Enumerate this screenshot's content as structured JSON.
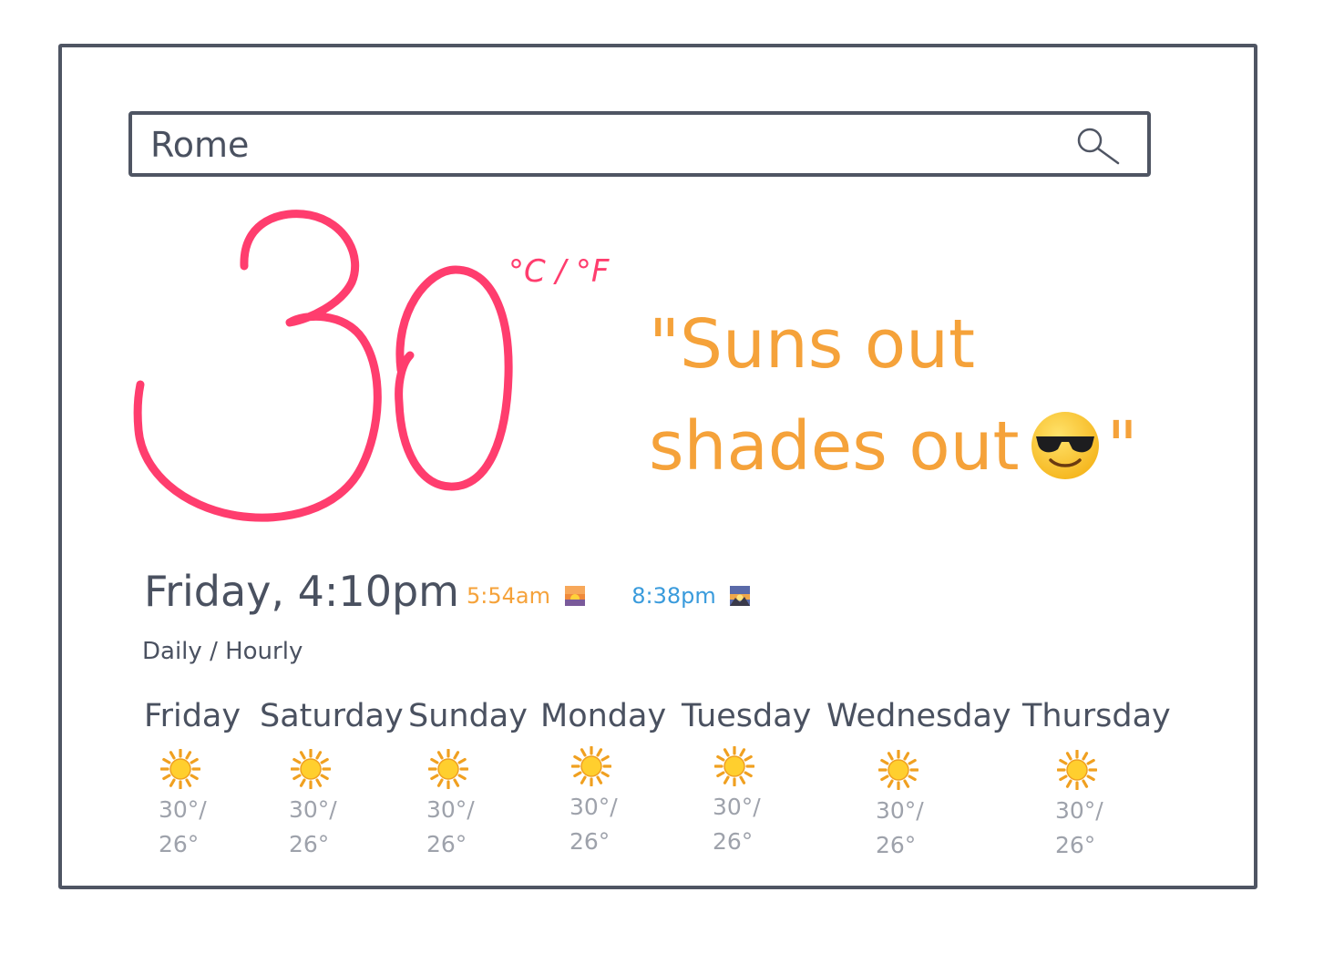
{
  "search": {
    "value": "Rome",
    "icon": "search-icon"
  },
  "current": {
    "temperature": "30",
    "unit_celsius": "°C",
    "unit_separator": "/",
    "unit_fahrenheit": "°F",
    "quote_line1": "\"Suns out",
    "quote_line2_text": "shades out",
    "quote_line2_emoji": "sunglasses-face-icon",
    "quote_end": "\"",
    "datetime": "Friday, 4:10pm",
    "sunrise": "5:54am",
    "sunset": "8:38pm"
  },
  "mode": {
    "daily": "Daily",
    "separator": "/",
    "hourly": "Hourly"
  },
  "forecast": [
    {
      "day": "Friday",
      "icon": "sun-icon",
      "high": "30°/",
      "low": "26°"
    },
    {
      "day": "Saturday",
      "icon": "sun-icon",
      "high": "30°/",
      "low": "26°"
    },
    {
      "day": "Sunday",
      "icon": "sun-icon",
      "high": "30°/",
      "low": "26°"
    },
    {
      "day": "Monday",
      "icon": "sun-icon",
      "high": "30°/",
      "low": "26°"
    },
    {
      "day": "Tuesday",
      "icon": "sun-icon",
      "high": "30°/",
      "low": "26°"
    },
    {
      "day": "Wednesday",
      "icon": "sun-icon",
      "high": "30°/",
      "low": "26°"
    },
    {
      "day": "Thursday",
      "icon": "sun-icon",
      "high": "30°/",
      "low": "26°"
    }
  ],
  "colors": {
    "temperature": "#ff3d6e",
    "quote": "#f5a23a",
    "sunrise": "#f5a23a",
    "sunset": "#3a9bdc",
    "frame": "#4f5563",
    "muted": "#9ea2ab"
  }
}
